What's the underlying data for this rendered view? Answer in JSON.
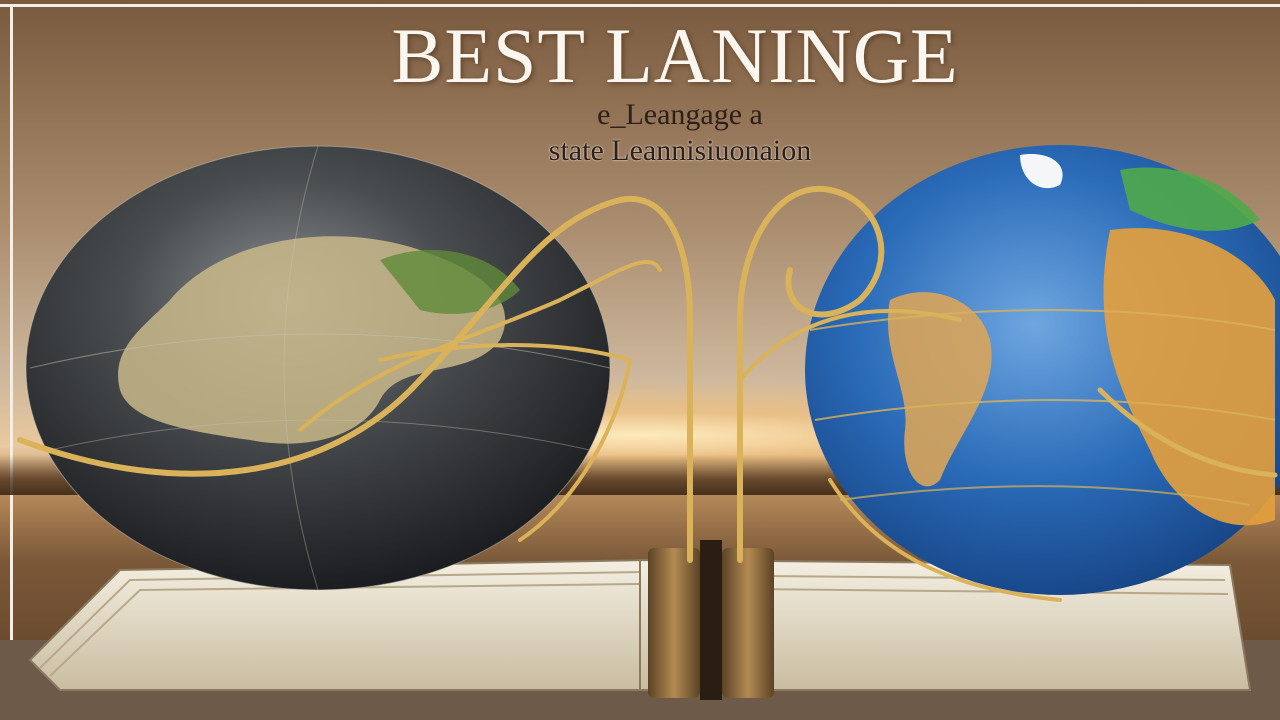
{
  "poster": {
    "title": "BEST LANINGE",
    "subtitle_line1": "e_Leangage a",
    "subtitle_line2": "state Leannisiuonaion"
  },
  "colors": {
    "background": "#a88a6c",
    "title_text": "#fbf6ef",
    "subtitle_text": "#2e2018",
    "ribbon_gold": "#d9b25a",
    "ocean_blue": "#2a6bb8",
    "dark_globe": "#2a2e33"
  },
  "icons": [
    "dark-globe-icon",
    "color-globe-icon",
    "open-book-icon",
    "gold-ribbon-icon"
  ]
}
